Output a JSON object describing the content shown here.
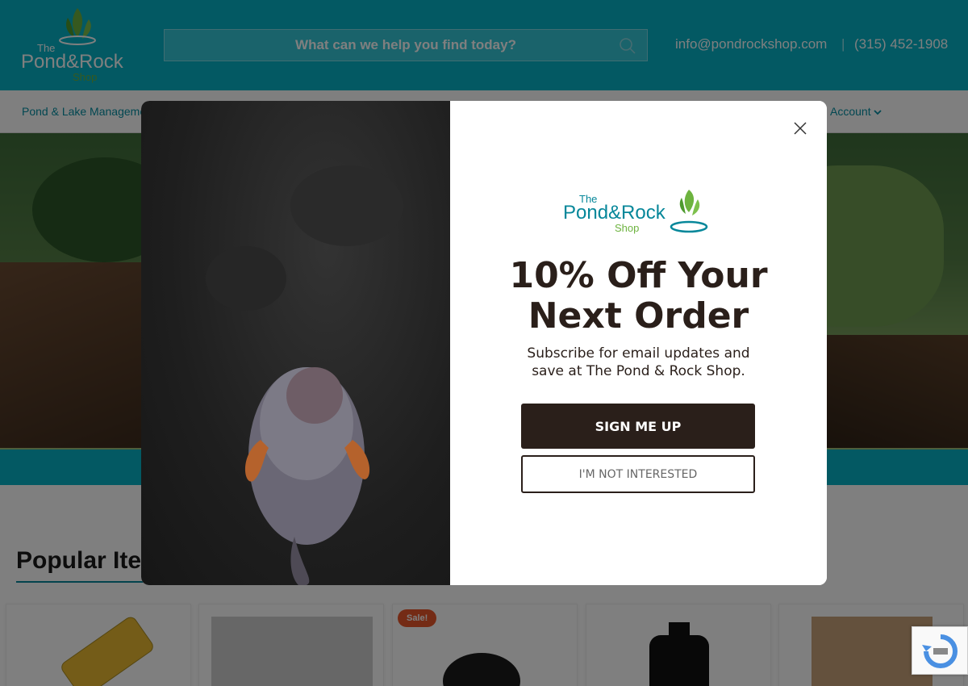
{
  "header": {
    "search_placeholder": "What can we help you find today?",
    "email": "info@pondrockshop.com",
    "separator": "|",
    "phone": "(315) 452-1908"
  },
  "nav": {
    "items": [
      "Pond & Lake Management",
      "Account"
    ]
  },
  "main": {
    "section_title": "Popular Items",
    "sale_badge": "Sale!"
  },
  "modal": {
    "logo_line1": "The",
    "logo_line2": "Pond&Rock",
    "logo_line3": "Shop",
    "headline_line1": "10% Off Your",
    "headline_line2": "Next Order",
    "subtext": "Subscribe for email updates and save at The Pond & Rock Shop.",
    "primary_button": "SIGN ME UP",
    "secondary_button": "I'M NOT INTERESTED"
  },
  "colors": {
    "brand_teal": "#06b3c7",
    "brand_green": "#6db33f",
    "button_dark": "#2a1f1a"
  }
}
